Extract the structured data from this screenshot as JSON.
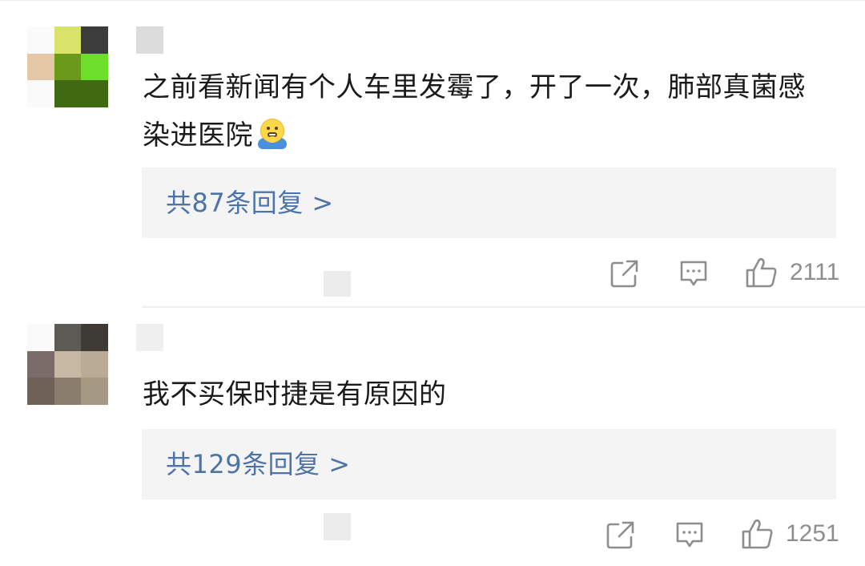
{
  "comments": [
    {
      "text": "之前看新闻有个人车里发霉了，开了一次，肺部真菌感染进医院",
      "emoji_icon": "pleading-face-icon",
      "replies_label": "共87条回复 >",
      "like_count": "2111",
      "avatar_colors": [
        "#fafafa",
        "#d9e36a",
        "#3c3c3c",
        "#e5c7a6",
        "#6b9a1a",
        "#6ddf2a",
        "#fafafa",
        "#3f6a12",
        "#3f6a12"
      ]
    },
    {
      "text": "我不买保时捷是有原因的",
      "replies_label": "共129条回复 >",
      "like_count": "1251",
      "avatar_colors": [
        "#fafafa",
        "#5c5a55",
        "#3e3a36",
        "#7a6c68",
        "#c6b8a2",
        "#b9ab95",
        "#6e6258",
        "#8a7d6d",
        "#a59885"
      ]
    }
  ],
  "colors": {
    "link": "#4d74a8",
    "meta": "#8e8e8e",
    "text": "#1a1a1a",
    "reply_bg": "#f4f4f4"
  },
  "icons": {
    "share": "share-icon",
    "comment": "comment-icon",
    "like": "thumbs-up-icon"
  }
}
